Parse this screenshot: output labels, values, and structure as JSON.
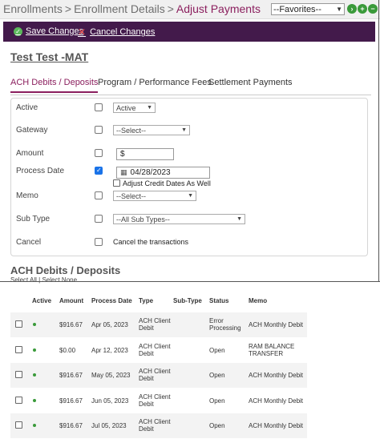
{
  "breadcrumb": {
    "items": [
      "Enrollments",
      "Enrollment Details"
    ],
    "separator": ">",
    "current": "Adjust Payments"
  },
  "favorites": {
    "selected": "--Favorites--"
  },
  "toolbar": {
    "save_label": "Save Changes",
    "cancel_label": "Cancel Changes"
  },
  "person_name": "Test Test -MAT",
  "tabs": [
    {
      "label": "ACH Debits / Deposits",
      "active": true
    },
    {
      "label": "Program / Performance Fees",
      "active": false
    },
    {
      "label": "Settlement Payments",
      "active": false
    }
  ],
  "form": {
    "active": {
      "label": "Active",
      "checked": false,
      "value": "Active"
    },
    "gateway": {
      "label": "Gateway",
      "checked": false,
      "value": "--Select--"
    },
    "amount": {
      "label": "Amount",
      "checked": false,
      "value": "$"
    },
    "process_date": {
      "label": "Process Date",
      "checked": true,
      "value": "04/28/2023",
      "adjust_label": "Adjust Credit Dates As Well"
    },
    "memo": {
      "label": "Memo",
      "checked": false,
      "value": "--Select--"
    },
    "sub_type": {
      "label": "Sub Type",
      "checked": false,
      "value": "--All Sub Types--"
    },
    "cancel": {
      "label": "Cancel",
      "checked": false,
      "text": "Cancel the transactions"
    }
  },
  "section": {
    "title": "ACH Debits / Deposits",
    "select_all": "Select All",
    "link_separator": "|",
    "select_none": "Select None"
  },
  "table": {
    "headers": [
      "Active",
      "Amount",
      "Process Date",
      "Type",
      "Sub-Type",
      "Status",
      "Memo"
    ],
    "rows": [
      {
        "amount": "$916.67",
        "date": "Apr 05, 2023",
        "type_l1": "ACH Client",
        "type_l2": "Debit",
        "subtype": "",
        "status_l1": "Error",
        "status_l2": "Processing",
        "memo_l1": "ACH Monthly Debit",
        "memo_l2": ""
      },
      {
        "amount": "$0.00",
        "date": "Apr 12, 2023",
        "type_l1": "ACH Client",
        "type_l2": "Debit",
        "subtype": "",
        "status_l1": "Open",
        "status_l2": "",
        "memo_l1": "RAM BALANCE",
        "memo_l2": "TRANSFER"
      },
      {
        "amount": "$916.67",
        "date": "May 05, 2023",
        "type_l1": "ACH Client",
        "type_l2": "Debit",
        "subtype": "",
        "status_l1": "Open",
        "status_l2": "",
        "memo_l1": "ACH Monthly Debit",
        "memo_l2": ""
      },
      {
        "amount": "$916.67",
        "date": "Jun 05, 2023",
        "type_l1": "ACH Client",
        "type_l2": "Debit",
        "subtype": "",
        "status_l1": "Open",
        "status_l2": "",
        "memo_l1": "ACH Monthly Debit",
        "memo_l2": ""
      },
      {
        "amount": "$916.67",
        "date": "Jul 05, 2023",
        "type_l1": "ACH Client",
        "type_l2": "Debit",
        "subtype": "",
        "status_l1": "Open",
        "status_l2": "",
        "memo_l1": "ACH Monthly Debit",
        "memo_l2": ""
      }
    ]
  },
  "colors": {
    "accent": "#8b1f5e",
    "toolbar_bg": "#431a4b",
    "active_dot": "#3a9a3a"
  }
}
